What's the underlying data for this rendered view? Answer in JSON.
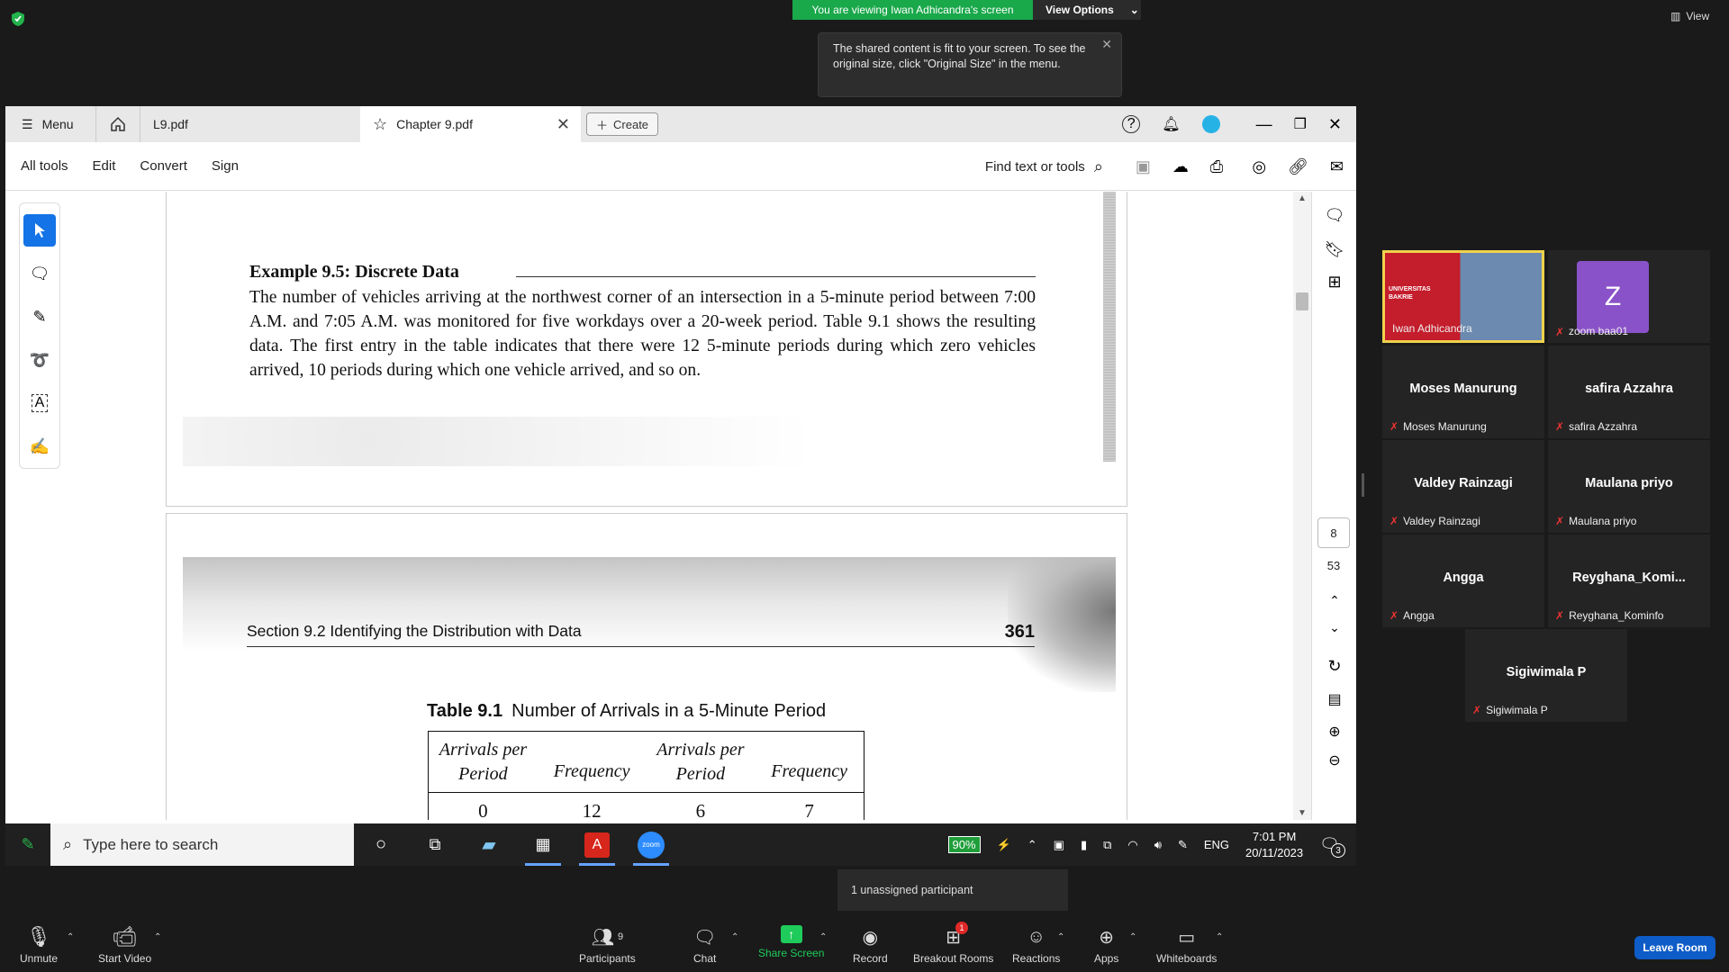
{
  "zoom_top": {
    "viewing_banner": "You are viewing Iwan Adhicandra's screen",
    "view_options": "View Options",
    "view_label": "View",
    "tooltip": "The shared content is fit to your screen. To see the original size, click \"Original Size\" in the menu."
  },
  "acrobat": {
    "menu_label": "Menu",
    "tabs": [
      {
        "label": "L9.pdf"
      },
      {
        "label": "Chapter 9.pdf"
      }
    ],
    "create_label": "Create",
    "toolbar_items": [
      "All tools",
      "Edit",
      "Convert",
      "Sign"
    ],
    "find_label": "Find text or tools",
    "page_current": "8",
    "page_total": "53"
  },
  "document": {
    "example_title": "Example 9.5:    Discrete Data",
    "example_body": "The number of vehicles arriving at the northwest corner of an intersection in a 5-minute period between 7:00 A.M. and 7:05 A.M. was monitored for five workdays over a 20-week period. Table 9.1 shows the resulting data. The first entry in the table indicates that there were 12 5-minute periods during which zero vehicles arrived, 10 periods during which one vehicle arrived, and so on.",
    "section_header": "Section 9.2   Identifying the Distribution with Data",
    "page_number": "361",
    "table_label": "Table 9.1",
    "table_caption": "Number of Arrivals in a 5-Minute Period",
    "table_headers": [
      "Arrivals per Period",
      "Frequency",
      "Arrivals per Period",
      "Frequency"
    ],
    "table_rows": [
      [
        "0",
        "12",
        "6",
        "7"
      ]
    ]
  },
  "taskbar": {
    "search_placeholder": "Type here to search",
    "battery": "90%",
    "language": "ENG",
    "time": "7:01 PM",
    "date": "20/11/2023",
    "notification_count": "3"
  },
  "unassigned": "1 unassigned participant",
  "participants": [
    {
      "name": "Iwan Adhicandra",
      "video": true,
      "video_text": "UNIVERSITAS BAKRIE"
    },
    {
      "name": "zoom baa01",
      "avatar_letter": "Z"
    },
    {
      "name": "Moses Manurung"
    },
    {
      "name": "safira Azzahra"
    },
    {
      "name": "Valdey Rainzagi"
    },
    {
      "name": "Maulana priyo"
    },
    {
      "name": "Angga"
    },
    {
      "name": "Reyghana_Komi...",
      "label": "Reyghana_Kominfo"
    },
    {
      "name": "Sigiwimala P"
    }
  ],
  "zoom_bar": {
    "unmute": "Unmute",
    "start_video": "Start Video",
    "participants": "Participants",
    "participants_count": "9",
    "chat": "Chat",
    "share_screen": "Share Screen",
    "record": "Record",
    "breakout_rooms": "Breakout Rooms",
    "breakout_badge": "1",
    "reactions": "Reactions",
    "apps": "Apps",
    "whiteboards": "Whiteboards",
    "leave_room": "Leave Room"
  },
  "colors": {
    "accent": "#1473e6",
    "zoom_green": "#19a84a",
    "leave_blue": "#0e5cc7",
    "highlight_tile": "#f0d24c"
  }
}
